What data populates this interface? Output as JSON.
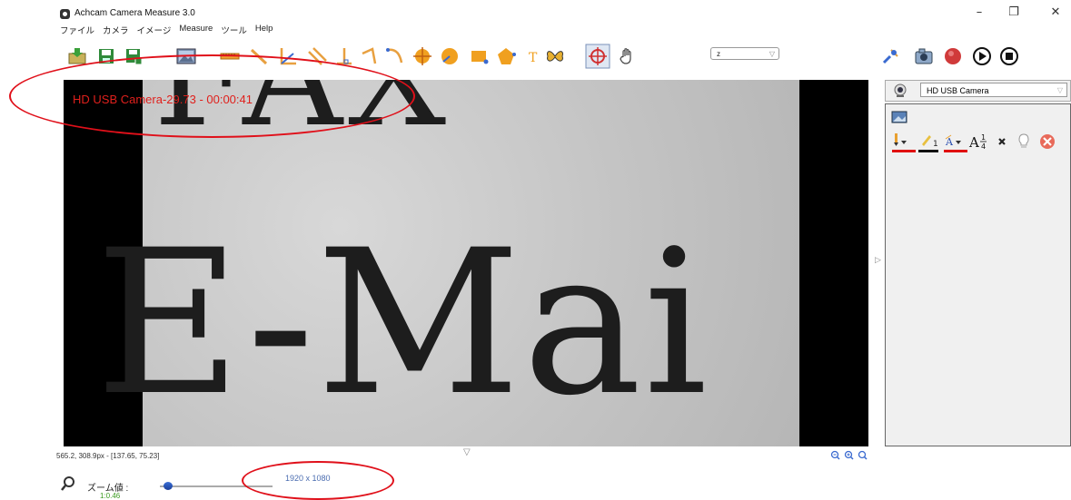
{
  "window": {
    "title": "Achcam Camera Measure 3.0"
  },
  "menu": [
    "ファイル",
    "カメラ",
    "イメージ",
    "Measure",
    "ツール",
    "Help"
  ],
  "toolbar": {
    "zoom_select_value": "z",
    "icons": [
      "open-folder-icon",
      "save-icon",
      "save-as-icon",
      "image-icon",
      "ruler-icon",
      "line-icon",
      "angle-icon",
      "parallel-lines-icon",
      "perpendicular-icon",
      "polyline-icon",
      "curve-icon",
      "circle-center-icon",
      "circle-icon",
      "rectangle-icon",
      "polygon-icon",
      "text-icon",
      "butterfly-icon",
      "crosshair-icon",
      "hand-icon",
      "calibrate-icon",
      "snapshot-icon",
      "record-icon",
      "play-icon",
      "stop-icon"
    ]
  },
  "video": {
    "overlay": "HD USB Camera-29.73 - 00:00:41",
    "paper_text_top": "FAX",
    "paper_text_main": "E-Mai"
  },
  "side_panel": {
    "camera_select": "HD USB Camera",
    "font_size_sup": "1",
    "font_size_sub": "4",
    "line_width": "1"
  },
  "status": {
    "cursor": "565.2, 308.9px - [137.65, 75.23]"
  },
  "zoom": {
    "label": "ズーム値 :",
    "ratio": "1:0.46",
    "level": 0.04,
    "resolution": "1920 x 1080"
  },
  "colors": {
    "overlay": "#e0201c",
    "annotation": "#e0101a",
    "ratio_green": "#3a9a20",
    "resolution_blue": "#4a6cb0"
  }
}
